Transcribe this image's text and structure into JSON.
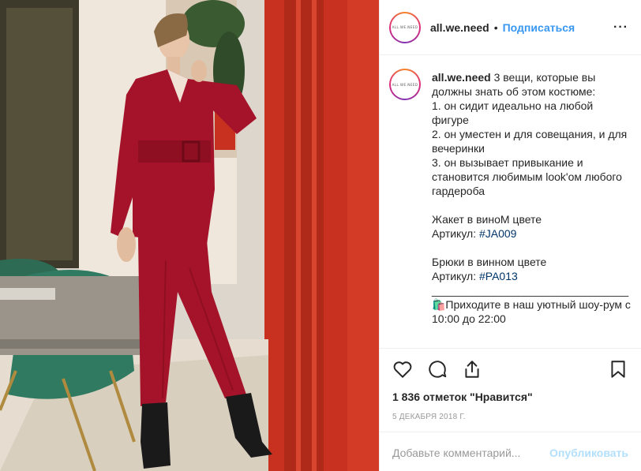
{
  "post": {
    "username": "all.we.need",
    "avatar_text": "all.we.need",
    "separator": "•",
    "follow_label": "Подписаться",
    "more_label": "···",
    "caption_username": "all.we.need",
    "caption_lines": [
      " 3 вещи, которые вы должны знать об этом костюме:\n1. он сидит идеально на любой фигуре\n2. он уместен и для совещания, и для вечеринки\n3. он вызывает привыкание и становится любимым look'ом любого гардероба\n\nЖакет в виноM цвете\nАртикул: "
    ],
    "jacket_label": "Жакет в виноM цвете",
    "caption_part1": " 3 вещи, которые вы должны знать об этом костюме:\n1. он сидит идеально на любой фигуре\n2. он уместен и для совещания, и для вечеринки\n3. он вызывает привыкание и становится любимым look'ом любого гардероба\n\nЖакет в виноM цвете\nАртикул: ",
    "tag1": "#JA009",
    "caption_part2": "\n\nБрюки в винном цвете\nАртикул: ",
    "tag2": "#PA013",
    "caption_part3": "\n________________________________\n🛍️Приходите в наш уютный шоу-рум с 10:00 до 22:00",
    "likes": "1 836 отметок \"Нравится\"",
    "date": "5 декабря 2018 г.",
    "comment_placeholder": "Добавьте комментарий...",
    "publish_label": "Опубликовать"
  },
  "icons": {
    "like": "heart-icon",
    "comment": "comment-icon",
    "share": "share-icon",
    "save": "bookmark-icon"
  },
  "colors": {
    "link": "#3897f0",
    "hashtag": "#003569",
    "suit": "#a5132a",
    "wall": "#c8311f",
    "publish_disabled": "#b2dffc"
  }
}
